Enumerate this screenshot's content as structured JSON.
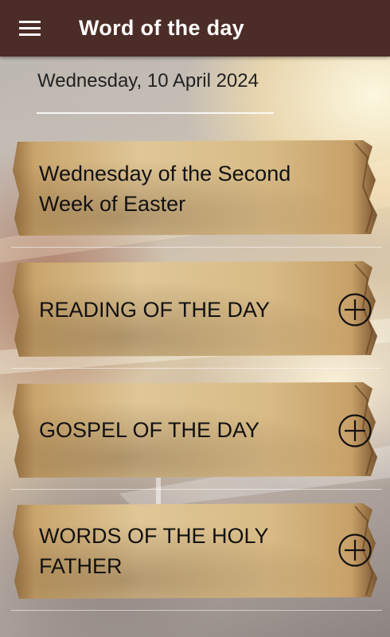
{
  "appbar": {
    "title": "Word of the day",
    "menu_icon": "hamburger-menu-icon"
  },
  "date": "Wednesday, 10 April 2024",
  "cards": [
    {
      "label": "Wednesday of the Second Week of Easter",
      "has_expand": false
    },
    {
      "label": "READING OF THE DAY",
      "has_expand": true,
      "icon": "plus-circle-icon"
    },
    {
      "label": "GOSPEL OF THE DAY",
      "has_expand": true,
      "icon": "plus-circle-icon"
    },
    {
      "label": "WORDS OF THE HOLY FATHER",
      "has_expand": true,
      "icon": "plus-circle-icon"
    }
  ],
  "colors": {
    "appbar": "#4b2c26",
    "parchment": "#d7bc8e",
    "text": "#111111"
  }
}
